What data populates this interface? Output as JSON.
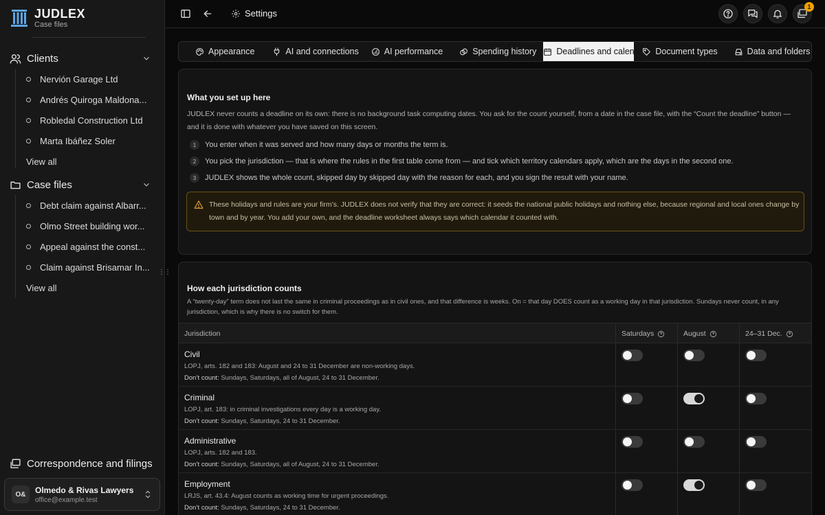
{
  "brand": {
    "name": "JUDLEX",
    "subtitle": "Case files"
  },
  "sidebar": {
    "clients": {
      "label": "Clients",
      "items": [
        "Nervión Garage Ltd",
        "Andrés Quiroga Maldona...",
        "Robledal Construction Ltd",
        "Marta Ibáñez Soler"
      ],
      "view_all": "View all"
    },
    "case_files": {
      "label": "Case files",
      "items": [
        "Debt claim against Albarr...",
        "Olmo Street building wor...",
        "Appeal against the const...",
        "Claim against Brisamar In..."
      ],
      "view_all": "View all"
    },
    "correspondence": "Correspondence and filings",
    "account": {
      "initials": "O&",
      "name": "Olmedo & Rivas Lawyers",
      "email": "office@example.test"
    }
  },
  "topbar": {
    "title": "Settings",
    "notifications_badge": "1"
  },
  "tabs": [
    {
      "label": "Appearance",
      "icon": "palette-icon"
    },
    {
      "label": "AI and connections",
      "icon": "plug-icon"
    },
    {
      "label": "AI performance",
      "icon": "gauge-icon"
    },
    {
      "label": "Spending history",
      "icon": "coins-icon"
    },
    {
      "label": "Deadlines and calendars",
      "icon": "calendar-icon"
    },
    {
      "label": "Document types",
      "icon": "tag-icon"
    },
    {
      "label": "Data and folders",
      "icon": "drive-icon"
    }
  ],
  "setup": {
    "title": "What you set up here",
    "intro": "JUDLEX never counts a deadline on its own: there is no background task computing dates. You ask for the count yourself, from a date in the case file, with the “Count the deadline” button — and it is done with whatever you have saved on this screen.",
    "steps": [
      {
        "num": "1",
        "text": "You enter when it was served and how many days or months the term is."
      },
      {
        "num": "2",
        "text": "You pick the jurisdiction — that is where the rules in the first table come from — and tick which territory calendars apply, which are the days in the second one."
      },
      {
        "num": "3",
        "text": "JUDLEX shows the whole count, skipped day by skipped day with the reason for each, and you sign the result with your name."
      }
    ],
    "warning": "These holidays and rules are your firm’s. JUDLEX does not verify that they are correct: it seeds the national public holidays and nothing else, because regional and local ones change by town and by year. You add your own, and the deadline worksheet always says which calendar it counted with."
  },
  "jurisdictions": {
    "title": "How each jurisdiction counts",
    "description": "A “twenty-day” term does not last the same in criminal proceedings as in civil ones, and that difference is weeks. On = that day DOES count as a working day in that jurisdiction. Sundays never count, in any jurisdiction, which is why there is no switch for them.",
    "columns": {
      "name": "Jurisdiction",
      "saturdays": "Saturdays",
      "august": "August",
      "dec": "24–31 Dec."
    },
    "dont_count_label": "Don’t count:",
    "rows": [
      {
        "name": "Civil",
        "rule": "LOPJ, arts. 182 and 183: August and 24 to 31 December are non-working days.",
        "dont_count": "Sundays, Saturdays, all of August, 24 to 31 December.",
        "saturdays": false,
        "august": false,
        "dec": false
      },
      {
        "name": "Criminal",
        "rule": "LOPJ, art. 183: in criminal investigations every day is a working day.",
        "dont_count": "Sundays, Saturdays, 24 to 31 December.",
        "saturdays": false,
        "august": true,
        "dec": false
      },
      {
        "name": "Administrative",
        "rule": "LOPJ, arts. 182 and 183.",
        "dont_count": "Sundays, Saturdays, all of August, 24 to 31 December.",
        "saturdays": false,
        "august": false,
        "dec": false
      },
      {
        "name": "Employment",
        "rule": "LRJS, art. 43.4: August counts as working time for urgent proceedings.",
        "dont_count": "Sundays, Saturdays, 24 to 31 December.",
        "saturdays": false,
        "august": true,
        "dec": false
      }
    ]
  }
}
